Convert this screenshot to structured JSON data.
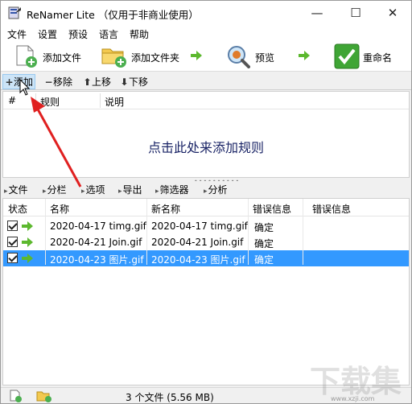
{
  "window": {
    "title": "ReNamer Lite （仅用于非商业使用）",
    "controls": {
      "minimize": "—",
      "maximize": "☐",
      "close": "✕"
    }
  },
  "menu": {
    "items": [
      {
        "label": "文件"
      },
      {
        "label": "设置"
      },
      {
        "label": "预设"
      },
      {
        "label": "语言"
      },
      {
        "label": "帮助"
      }
    ]
  },
  "toolbar": {
    "add_files": "添加文件",
    "add_folder": "添加文件夹",
    "preview": "预览",
    "rename": "重命名"
  },
  "rules_toolbar": {
    "add": "添加",
    "remove": "移除",
    "up": "上移",
    "down": "下移"
  },
  "rules_table": {
    "columns": [
      "#",
      "规则",
      "说明"
    ],
    "placeholder": "点击此处来添加规则"
  },
  "files_toolbar": {
    "files": "文件",
    "columns": "分栏",
    "options": "选项",
    "export": "导出",
    "filter": "筛选器",
    "analyze": "分析"
  },
  "files_table": {
    "columns": {
      "state": "状态",
      "name": "名称",
      "new_name": "新名称",
      "error1": "错误信息",
      "error2": "错误信息"
    },
    "rows": [
      {
        "name": "2020-04-17 timg.gif",
        "new_name": "2020-04-17 timg.gif",
        "error": "确定",
        "checked": true,
        "selected": false
      },
      {
        "name": "2020-04-21 Join.gif",
        "new_name": "2020-04-21 Join.gif",
        "error": "确定",
        "checked": true,
        "selected": false
      },
      {
        "name": "2020-04-23 图片.gif",
        "new_name": "2020-04-23 图片.gif",
        "error": "确定",
        "checked": true,
        "selected": true
      }
    ]
  },
  "status": {
    "text": "3 个文件 (5.56 MB)"
  },
  "watermark": {
    "text": "下载集",
    "url": "www.xzji.com"
  },
  "colors": {
    "selection": "#3399ff",
    "placeholder_text": "#1a2466",
    "annotation_arrow": "#e02020",
    "green_arrow": "#5cb82e"
  }
}
